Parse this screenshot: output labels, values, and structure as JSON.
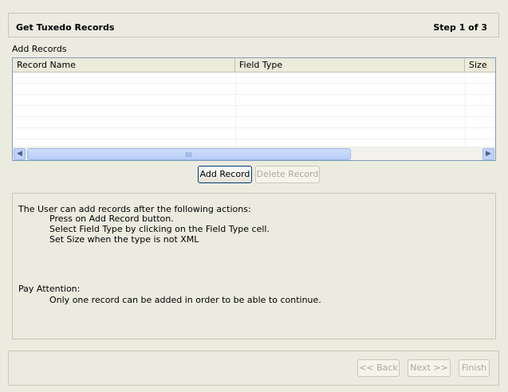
{
  "header": {
    "title": "Get Tuxedo Records",
    "step": "Step 1 of 3"
  },
  "records": {
    "section_label": "Add Records",
    "columns": [
      "Record Name",
      "Field Type",
      "Size"
    ],
    "rows": []
  },
  "actions": {
    "add_record": "Add Record",
    "delete_record": "Delete Record"
  },
  "instructions": {
    "intro": "The User can add records after the following actions:",
    "steps": [
      "Press on Add Record button.",
      "Select Field Type by clicking on the Field Type cell.",
      "Set Size when the type is not XML"
    ],
    "attention_title": "Pay Attention:",
    "attention_text": "Only one record can be added in order to be able to continue."
  },
  "wizard_nav": {
    "back": "<< Back",
    "next": "Next >>",
    "finish": "Finish"
  },
  "colors": {
    "background": "#ecebe0",
    "table_border": "#7f9db9",
    "scrollbar_thumb": "#c1d3fb",
    "button_border": "#003c74",
    "disabled_text": "#aca899"
  }
}
